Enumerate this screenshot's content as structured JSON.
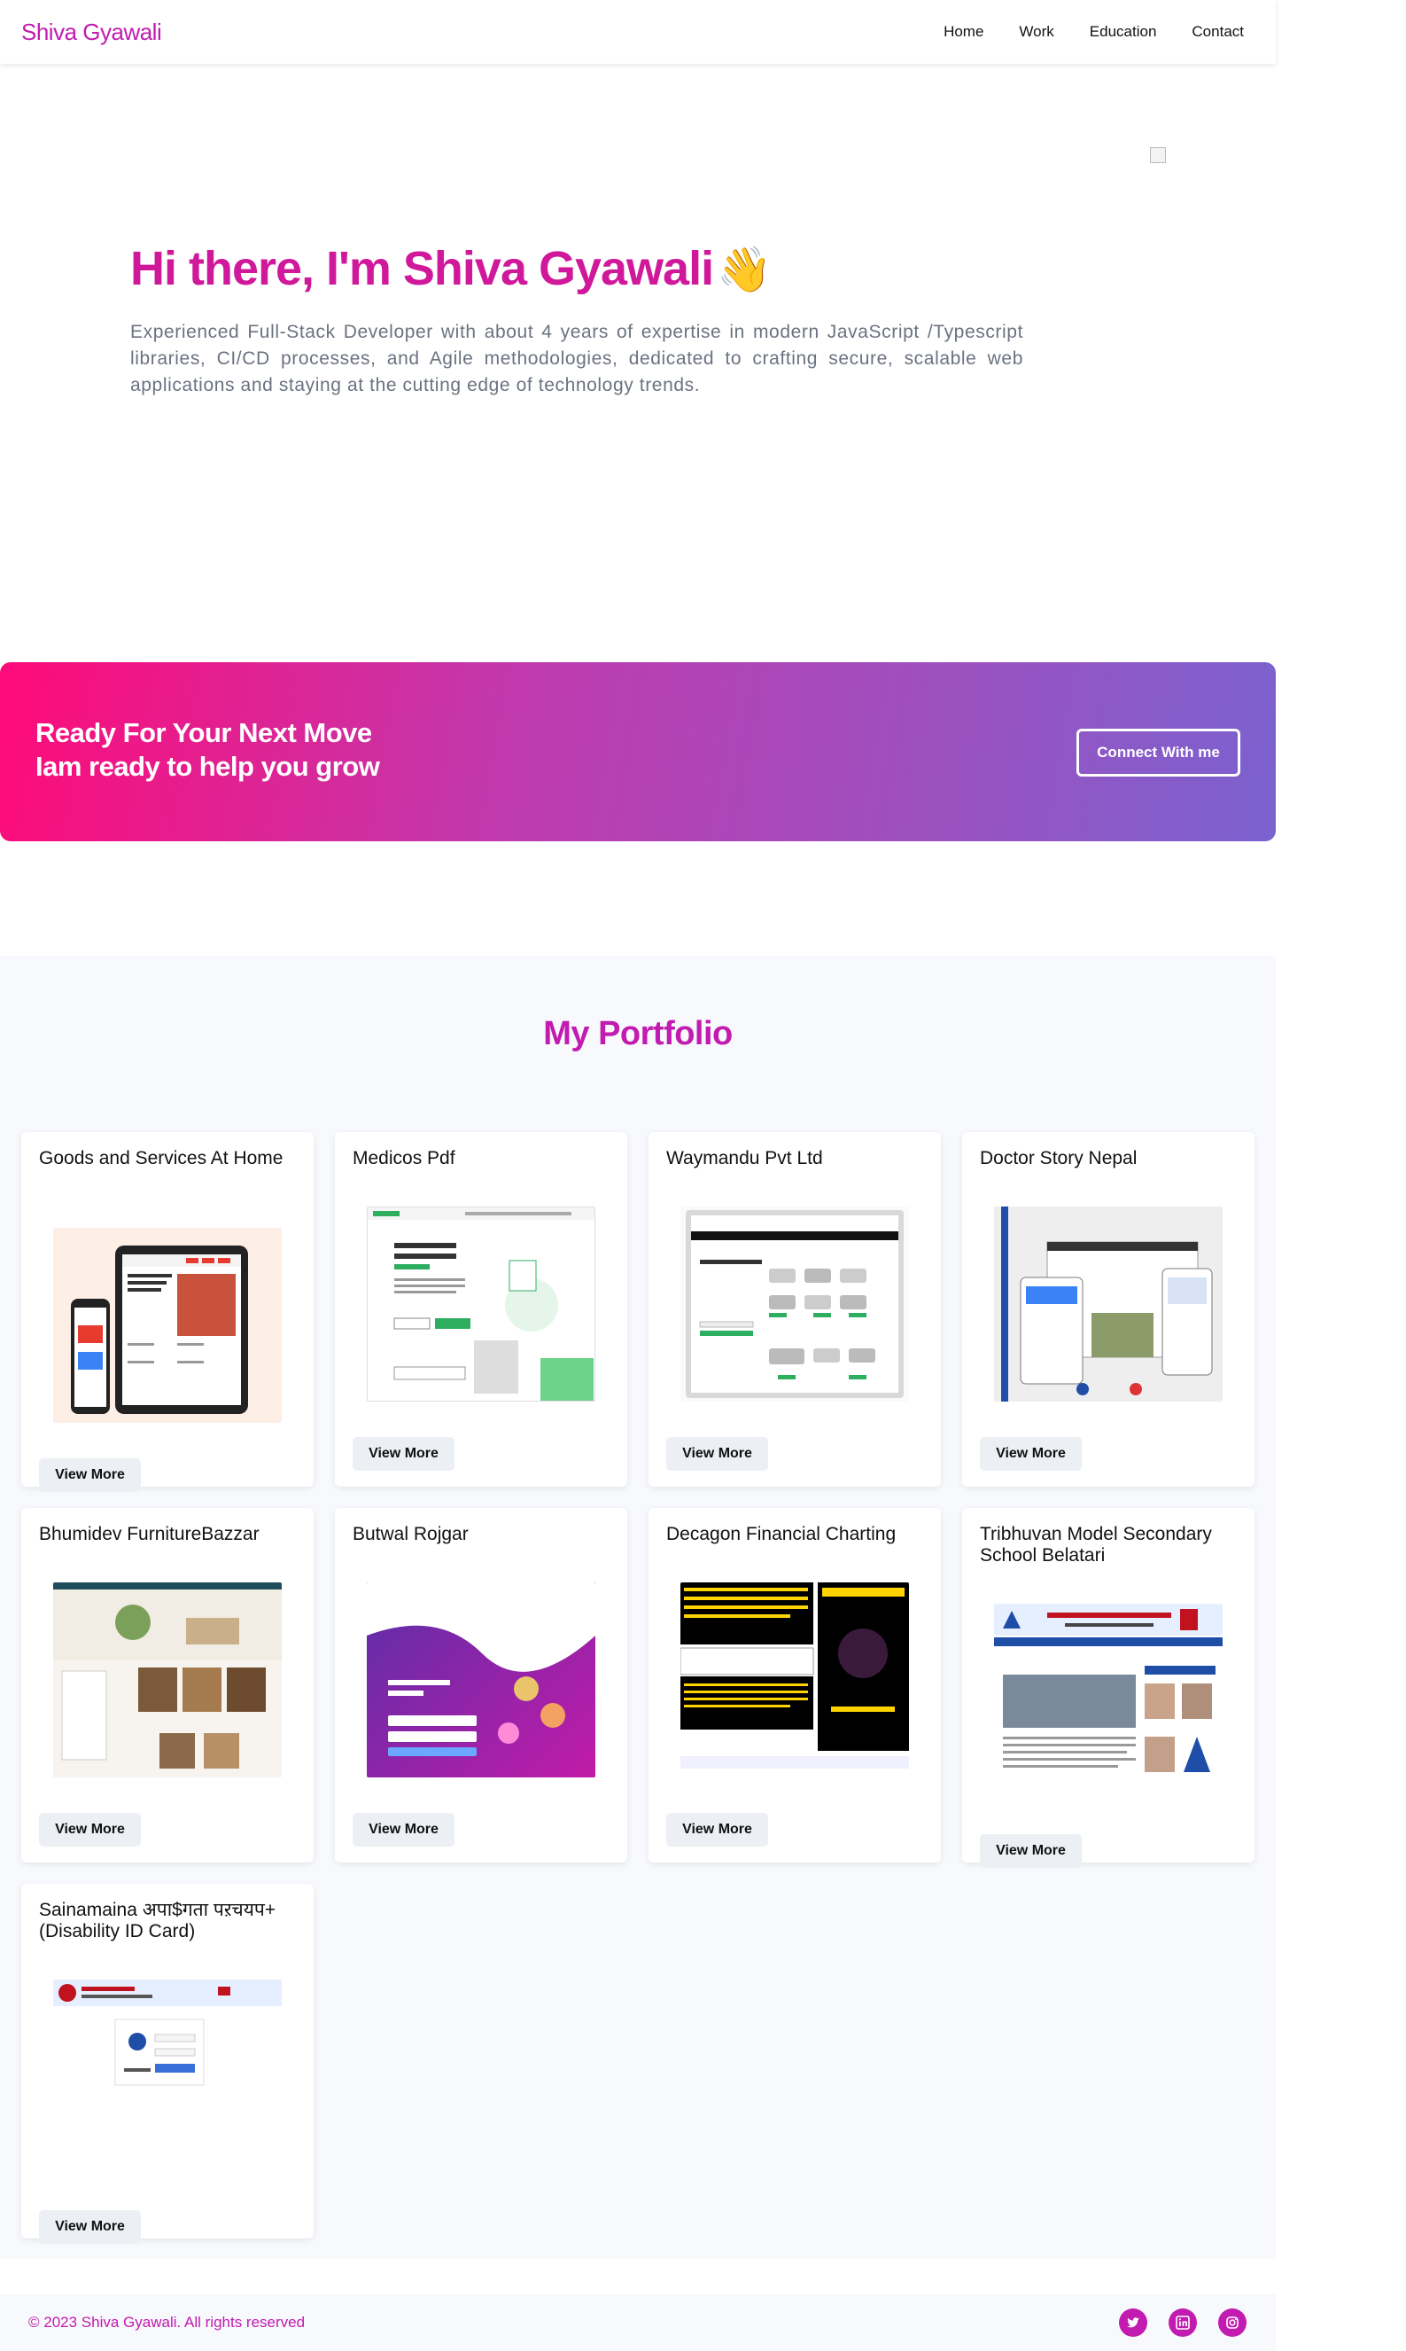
{
  "nav": {
    "brand": "Shiva Gyawali",
    "links": [
      "Home",
      "Work",
      "Education",
      "Contact"
    ]
  },
  "hero": {
    "title": "Hi there, I'm Shiva Gyawali",
    "wave_icon": "👋",
    "description": "Experienced Full-Stack Developer with about 4 years of expertise in modern JavaScript /Typescript libraries, CI/CD processes, and Agile methodologies, dedicated to crafting secure, scalable web applications and staying at the cutting edge of technology trends."
  },
  "cta": {
    "line1": "Ready For Your Next Move",
    "line2": "Iam ready to help you grow",
    "button": "Connect With me"
  },
  "portfolio": {
    "title": "My Portfolio",
    "view_label": "View More",
    "projects": [
      {
        "title": "Goods and Services At Home"
      },
      {
        "title": "Medicos Pdf"
      },
      {
        "title": "Waymandu Pvt Ltd"
      },
      {
        "title": "Doctor Story Nepal"
      },
      {
        "title": "Bhumidev FurnitureBazzar"
      },
      {
        "title": "Butwal Rojgar"
      },
      {
        "title": "Decagon Financial Charting"
      },
      {
        "title": "Tribhuvan Model Secondary School Belatari"
      },
      {
        "title": "Sainamaina अपा$गता पऱचयप+ (Disability ID Card)"
      }
    ]
  },
  "footer": {
    "copyright": "© 2023 Shiva Gyawali. All rights reserved",
    "social_icons": [
      "twitter-icon",
      "linkedin-icon",
      "instagram-icon"
    ]
  },
  "colors": {
    "brand": "#c21bb0",
    "hero_title": "#d0189a",
    "gradient_start": "#ff0a78",
    "gradient_end": "#7a62cf"
  }
}
